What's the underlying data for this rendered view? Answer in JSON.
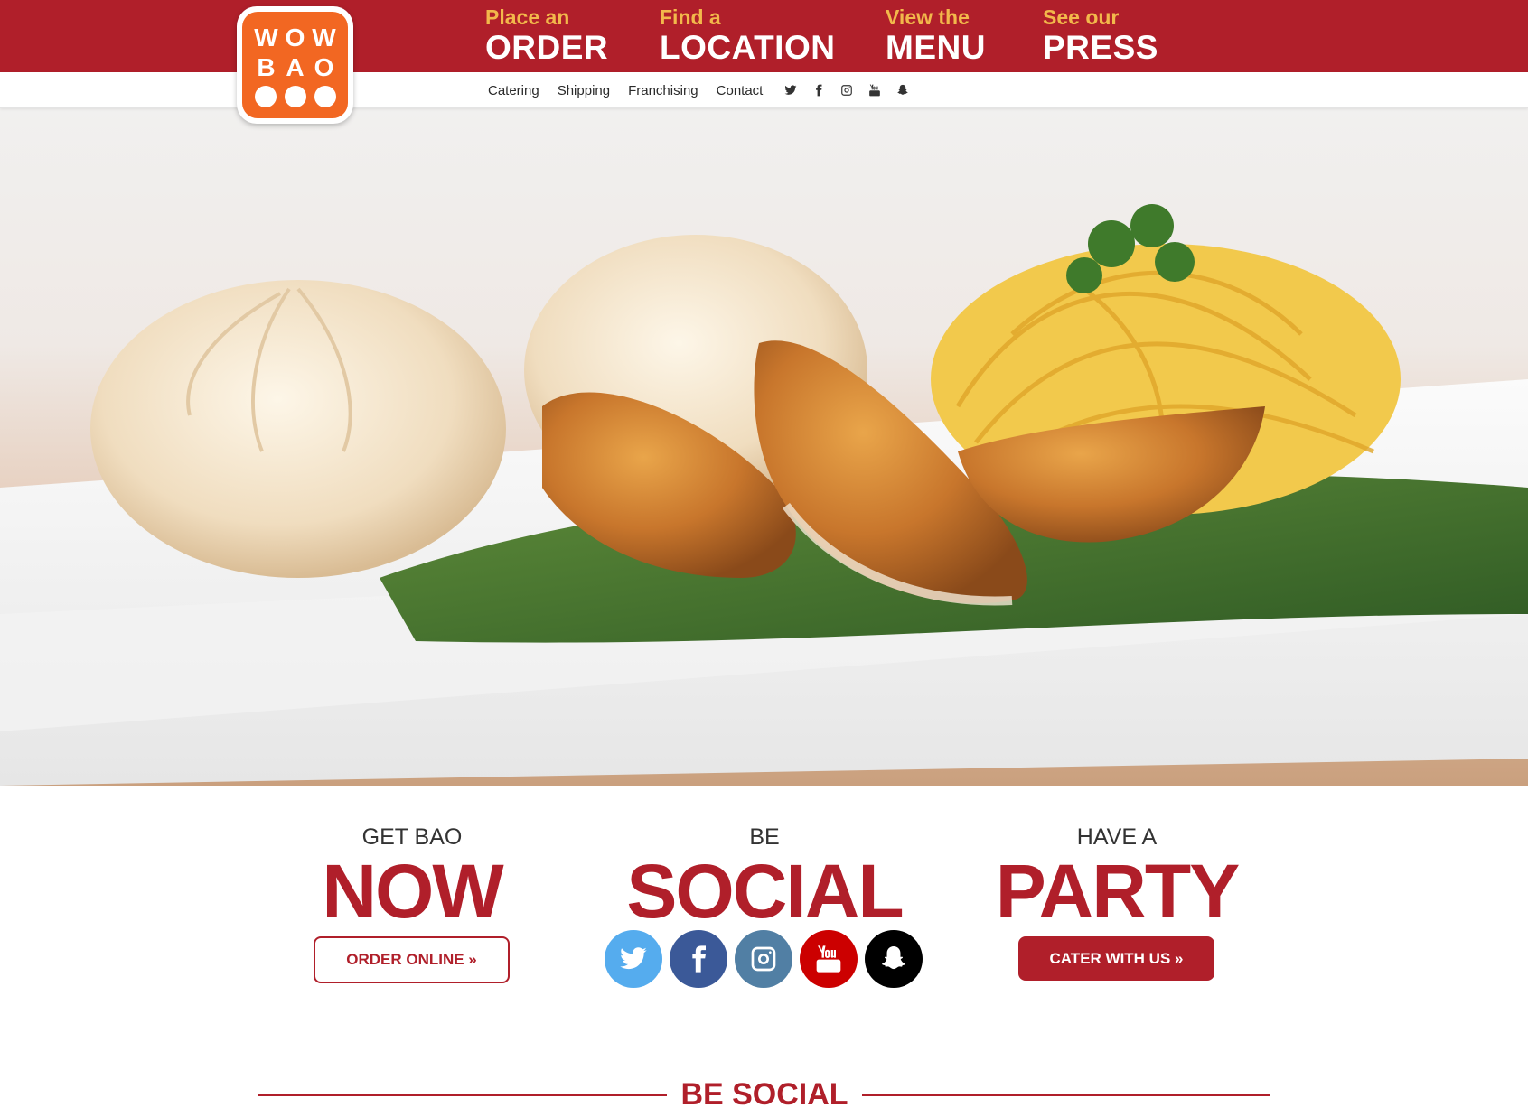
{
  "logo": {
    "row1": [
      "W",
      "O",
      "W"
    ],
    "row2": [
      "B",
      "A",
      "O"
    ],
    "color": "#f26722"
  },
  "main_nav": [
    {
      "small": "Place an",
      "big": "ORDER"
    },
    {
      "small": "Find a",
      "big": "LOCATION"
    },
    {
      "small": "View the",
      "big": "MENU"
    },
    {
      "small": "See our",
      "big": "PRESS"
    }
  ],
  "sub_nav": {
    "links": [
      "Catering",
      "Shipping",
      "Franchising",
      "Contact"
    ],
    "icons": [
      "twitter-icon",
      "facebook-icon",
      "instagram-icon",
      "youtube-icon",
      "snapchat-icon"
    ]
  },
  "cta": {
    "now": {
      "small": "GET BAO",
      "big": "NOW",
      "button": "ORDER ONLINE »"
    },
    "social": {
      "small": "BE",
      "big": "SOCIAL"
    },
    "party": {
      "small": "HAVE A",
      "big": "PARTY",
      "button": "CATER WITH US »"
    }
  },
  "social_buttons": [
    {
      "icon": "twitter-icon",
      "color": "#55acee"
    },
    {
      "icon": "facebook-icon",
      "color": "#3b5998"
    },
    {
      "icon": "instagram-icon",
      "color": "#517fa4"
    },
    {
      "icon": "youtube-icon",
      "color": "#cc0000"
    },
    {
      "icon": "snapchat-icon",
      "color": "#000000"
    }
  ],
  "section_heading": "BE SOCIAL",
  "colors": {
    "brand_red": "#b01f2a",
    "accent_gold": "#f2b84b"
  }
}
